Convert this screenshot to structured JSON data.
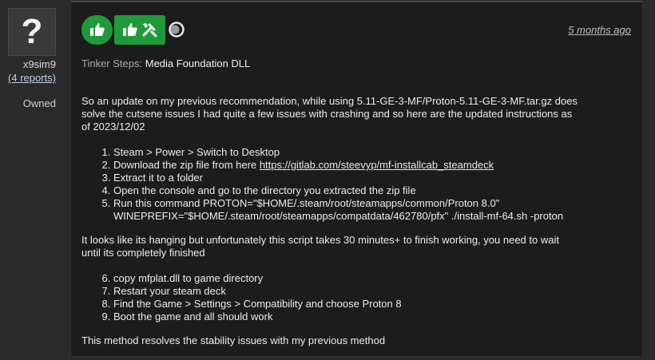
{
  "user": {
    "avatar_glyph": "?",
    "name": "x9sim9",
    "reports": "(4 reports)",
    "status": "Owned"
  },
  "review": {
    "timestamp": "5 months ago",
    "tinker_label": "Tinker Steps:",
    "tinker_value": "Media Foundation DLL",
    "intro": "So an update on my previous recommendation, while using 5.11-GE-3-MF/Proton-5.11-GE-3-MF.tar.gz does solve the cutsene issues I had quite a few issues with crashing and so here are the updated instructions as of 2023/12/02",
    "steps_a": {
      "s1": "Steam > Power > Switch to Desktop",
      "s2_prefix": "Download the zip file from here ",
      "s2_link": "https://gitlab.com/steevyp/mf-installcab_steamdeck",
      "s3": "Extract it to a folder",
      "s4": "Open the console and go to the directory you extracted the zip file",
      "s5_line1": "Run this command PROTON=\"$HOME/.steam/root/steamapps/common/Proton 8.0\"",
      "s5_line2": "WINEPREFIX=\"$HOME/.steam/root/steamapps/compatdata/462780/pfx\" ./install-mf-64.sh -proton"
    },
    "middle": "It looks like its hanging but unfortunately this script takes 30 minutes+ to finish working, you need to wait until its completely finished",
    "steps_b": {
      "s6": "copy mfplat.dll to game directory",
      "s7": "Restart your steam deck",
      "s8": "Find the Game > Settings > Compatibility and choose Proton 8",
      "s9": "Boot the game and all should work"
    },
    "outro": "This method resolves the stability issues with my previous method"
  },
  "badges": {
    "color": "#1f9a3a",
    "thumb_icon": "thumbs-up-icon",
    "tinker_icons": [
      "thumbs-up-icon",
      "tools-icon"
    ],
    "ring_icon": "loading-ring-icon"
  }
}
